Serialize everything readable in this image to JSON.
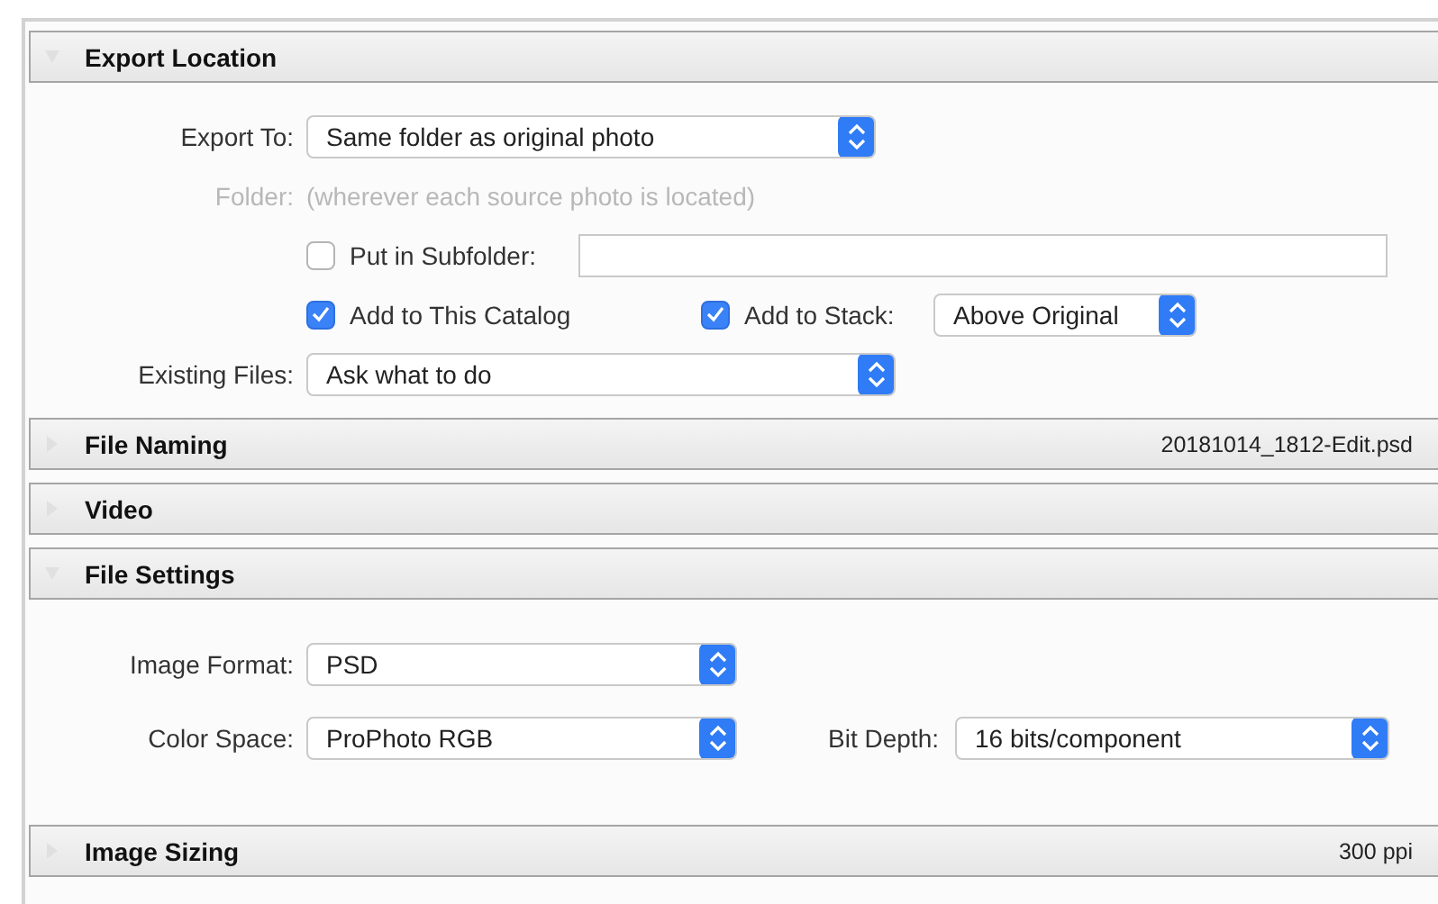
{
  "sections": [
    {
      "title": "Export Location",
      "expanded": true,
      "rows": [
        {
          "label": "Export To:",
          "items": [
            {
              "kind": "select",
              "value": "Same folder as original photo"
            }
          ]
        },
        {
          "label": "Folder:",
          "disabled": true,
          "items": [
            {
              "kind": "info",
              "value": "(wherever each source photo is located)"
            }
          ]
        },
        {
          "items": [
            {
              "kind": "checkbox",
              "label": "Put in Subfolder:",
              "checked": false
            },
            {
              "kind": "input"
            }
          ]
        },
        {
          "items": [
            {
              "kind": "checkbox",
              "label": "Add to This Catalog",
              "checked": true
            },
            {
              "kind": "checkbox",
              "label": "Add to Stack:",
              "checked": true
            },
            {
              "kind": "select",
              "value": "Above Original"
            }
          ]
        },
        {
          "label": "Existing Files:",
          "items": [
            {
              "kind": "select",
              "value": "Ask what to do"
            }
          ]
        }
      ]
    },
    {
      "title": "File Naming",
      "expanded": false,
      "summary": "20181014_1812-Edit.psd"
    },
    {
      "title": "Video",
      "expanded": false
    },
    {
      "title": "File Settings",
      "expanded": true,
      "rows": [
        {
          "label": "Image Format:",
          "items": [
            {
              "kind": "select",
              "value": "PSD"
            }
          ]
        },
        {
          "label": "Color Space:",
          "items": [
            {
              "kind": "select",
              "value": "ProPhoto RGB"
            },
            {
              "kind": "label",
              "value": "Bit Depth:"
            },
            {
              "kind": "select",
              "value": "16 bits/component"
            }
          ]
        }
      ]
    },
    {
      "title": "Image Sizing",
      "expanded": false,
      "summary": "300 ppi"
    }
  ]
}
